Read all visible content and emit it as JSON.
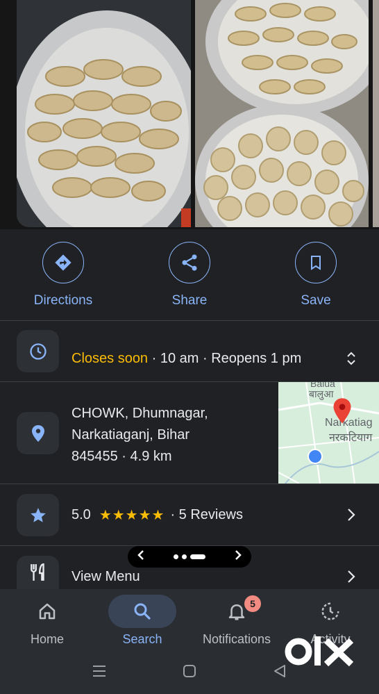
{
  "photos": [
    {
      "name": "momos-photo-1"
    },
    {
      "name": "momos-photo-2"
    },
    {
      "name": "momos-photo-3"
    }
  ],
  "actions": {
    "directions": "Directions",
    "share": "Share",
    "save": "Save"
  },
  "hours": {
    "status": "Closes soon",
    "detail": " · 10 am · Reopens 1 pm"
  },
  "address": {
    "line1": "CHOWK, Dhumnagar,",
    "line2": "Narkatiaganj, Bihar",
    "line3": "845455  ·  4.9 km"
  },
  "map": {
    "label_top_en": "Balua",
    "label_top_hi": "बालुआ",
    "label_town_en": "Narkatiag",
    "label_town_hi": "नरकटियाग"
  },
  "rating": {
    "value": "5.0",
    "stars": "★★★★★",
    "reviews": "· 5 Reviews"
  },
  "menu": {
    "label": "View Menu"
  },
  "nav": {
    "home": "Home",
    "search": "Search",
    "notifications": "Notifications",
    "activity": "Activity",
    "notif_count": "5"
  },
  "watermark": "OLX",
  "colors": {
    "background": "#202124",
    "accent": "#8ab4f8",
    "warning": "#fbbc04",
    "badge": "#f28b82"
  }
}
